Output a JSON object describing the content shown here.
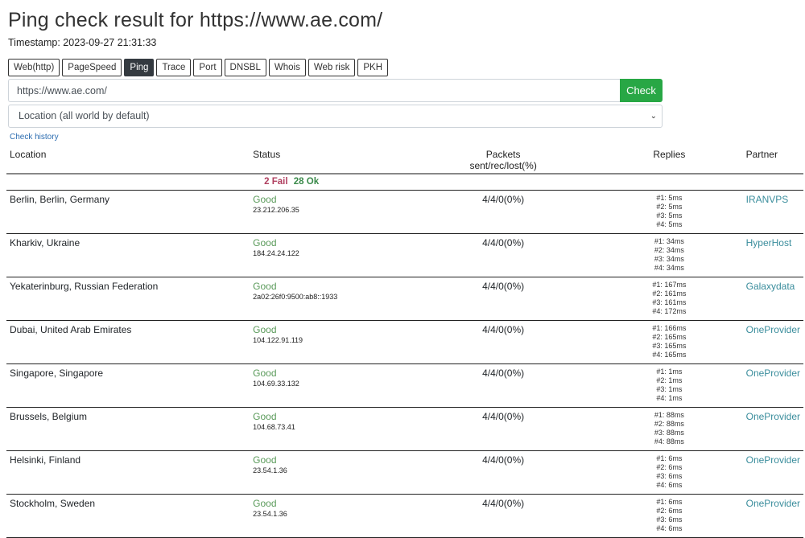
{
  "page": {
    "title": "Ping check result for https://www.ae.com/",
    "timestamp": "Timestamp: 2023-09-27 21:31:33"
  },
  "tools": [
    {
      "label": "Web(http)",
      "active": false
    },
    {
      "label": "PageSpeed",
      "active": false
    },
    {
      "label": "Ping",
      "active": true
    },
    {
      "label": "Trace",
      "active": false
    },
    {
      "label": "Port",
      "active": false
    },
    {
      "label": "DNSBL",
      "active": false
    },
    {
      "label": "Whois",
      "active": false
    },
    {
      "label": "Web risk",
      "active": false
    },
    {
      "label": "PKH",
      "active": false
    }
  ],
  "form": {
    "url_value": "https://www.ae.com/",
    "check_label": "Check",
    "location_selected": "Location (all world by default)",
    "check_history_label": "Check history"
  },
  "colors": {
    "check_button": "#28a745",
    "active_tab": "#343a40",
    "good": "#5a9a5a",
    "fail": "#b04060",
    "ok": "#3a8a4a",
    "partner_link": "#3a8d9c"
  },
  "table": {
    "headers": {
      "location": "Location",
      "status": "Status",
      "packets_line1": "Packets",
      "packets_line2": "sent/rec/lost(%)",
      "replies": "Replies",
      "partner": "Partner"
    },
    "summary": {
      "fail": "2 Fail",
      "ok": "28 Ok"
    },
    "rows": [
      {
        "location": "Berlin, Berlin, Germany",
        "status": "Good",
        "ip": "23.212.206.35",
        "packets": "4/4/0(0%)",
        "replies": [
          "#1: 5ms",
          "#2: 5ms",
          "#3: 5ms",
          "#4: 5ms"
        ],
        "partner": "IRANVPS"
      },
      {
        "location": "Kharkiv, Ukraine",
        "status": "Good",
        "ip": "184.24.24.122",
        "packets": "4/4/0(0%)",
        "replies": [
          "#1: 34ms",
          "#2: 34ms",
          "#3: 34ms",
          "#4: 34ms"
        ],
        "partner": "HyperHost"
      },
      {
        "location": "Yekaterinburg, Russian Federation",
        "status": "Good",
        "ip": "2a02:26f0:9500:ab8::1933",
        "packets": "4/4/0(0%)",
        "replies": [
          "#1: 167ms",
          "#2: 161ms",
          "#3: 161ms",
          "#4: 172ms"
        ],
        "partner": "Galaxydata"
      },
      {
        "location": "Dubai, United Arab Emirates",
        "status": "Good",
        "ip": "104.122.91.119",
        "packets": "4/4/0(0%)",
        "replies": [
          "#1: 166ms",
          "#2: 165ms",
          "#3: 165ms",
          "#4: 165ms"
        ],
        "partner": "OneProvider"
      },
      {
        "location": "Singapore, Singapore",
        "status": "Good",
        "ip": "104.69.33.132",
        "packets": "4/4/0(0%)",
        "replies": [
          "#1: 1ms",
          "#2: 1ms",
          "#3: 1ms",
          "#4: 1ms"
        ],
        "partner": "OneProvider"
      },
      {
        "location": "Brussels, Belgium",
        "status": "Good",
        "ip": "104.68.73.41",
        "packets": "4/4/0(0%)",
        "replies": [
          "#1: 88ms",
          "#2: 88ms",
          "#3: 88ms",
          "#4: 88ms"
        ],
        "partner": "OneProvider"
      },
      {
        "location": "Helsinki, Finland",
        "status": "Good",
        "ip": "23.54.1.36",
        "packets": "4/4/0(0%)",
        "replies": [
          "#1: 6ms",
          "#2: 6ms",
          "#3: 6ms",
          "#4: 6ms"
        ],
        "partner": "OneProvider"
      },
      {
        "location": "Stockholm, Sweden",
        "status": "Good",
        "ip": "23.54.1.36",
        "packets": "4/4/0(0%)",
        "replies": [
          "#1: 6ms",
          "#2: 6ms",
          "#3: 6ms",
          "#4: 6ms"
        ],
        "partner": "OneProvider"
      }
    ]
  }
}
